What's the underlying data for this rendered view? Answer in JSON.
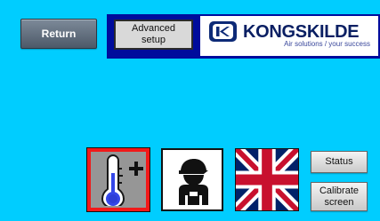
{
  "screen": {
    "background_color": "#00cdff"
  },
  "buttons": {
    "return_label": "Return",
    "advanced_setup_line1": "Advanced",
    "advanced_setup_line2": "setup",
    "status_label": "Status",
    "calibrate_line1": "Calibrate",
    "calibrate_line2": "screen"
  },
  "header": {
    "band_color": "#000c9c"
  },
  "branding": {
    "logo_text": "KONGSKILDE",
    "tagline": "Air solutions / your success",
    "logo_color": "#0a1f63"
  },
  "tiles": {
    "temperature": {
      "icon": "thermometer-plus-icon",
      "selected": true,
      "selected_border_color": "#f11919"
    },
    "operator": {
      "icon": "operator-icon"
    },
    "language": {
      "icon": "uk-flag-icon"
    }
  }
}
